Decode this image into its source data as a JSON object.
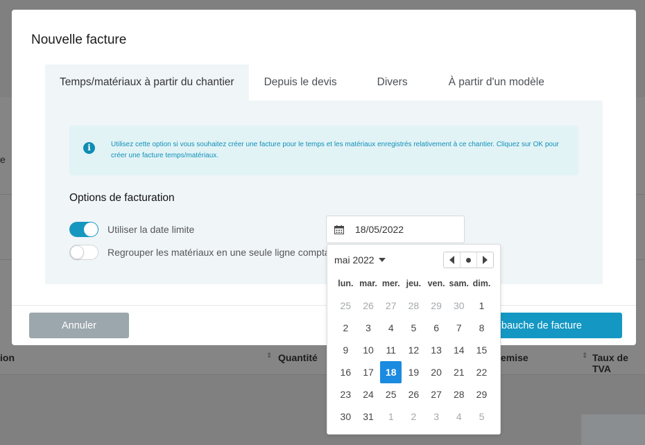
{
  "background": {
    "left_text": "e",
    "col_left": "ion",
    "col_quantite": "Quantité",
    "col_remise": "emise",
    "col_tva": "Taux de TVA"
  },
  "modal": {
    "title": "Nouvelle facture",
    "tabs": [
      {
        "label": "Temps/matériaux à partir du chantier",
        "active": true
      },
      {
        "label": "Depuis le devis",
        "active": false
      },
      {
        "label": "Divers",
        "active": false
      },
      {
        "label": "À partir d'un modèle",
        "active": false
      }
    ],
    "info_text": "Utilisez cette option si vous souhaitez créer une facture pour le temps et les matériaux enregistrés relativement à ce chantier. Cliquez sur OK pour créer une facture temps/matériaux.",
    "section_title": "Options de facturation",
    "options": [
      {
        "label": "Utiliser la date limite",
        "on": true
      },
      {
        "label": "Regrouper les matériaux en une seule ligne comptable",
        "on": false
      }
    ],
    "date_value": "18/05/2022",
    "cancel_label": "Annuler",
    "primary_label": "ébauche de facture"
  },
  "picker": {
    "month_label": "mai 2022",
    "weekdays": [
      "lun.",
      "mar.",
      "mer.",
      "jeu.",
      "ven.",
      "sam.",
      "dim."
    ],
    "days": [
      {
        "d": "25",
        "muted": true
      },
      {
        "d": "26",
        "muted": true
      },
      {
        "d": "27",
        "muted": true
      },
      {
        "d": "28",
        "muted": true
      },
      {
        "d": "29",
        "muted": true
      },
      {
        "d": "30",
        "muted": true
      },
      {
        "d": "1"
      },
      {
        "d": "2"
      },
      {
        "d": "3"
      },
      {
        "d": "4"
      },
      {
        "d": "5"
      },
      {
        "d": "6"
      },
      {
        "d": "7"
      },
      {
        "d": "8"
      },
      {
        "d": "9"
      },
      {
        "d": "10"
      },
      {
        "d": "11"
      },
      {
        "d": "12"
      },
      {
        "d": "13"
      },
      {
        "d": "14"
      },
      {
        "d": "15"
      },
      {
        "d": "16"
      },
      {
        "d": "17"
      },
      {
        "d": "18",
        "selected": true
      },
      {
        "d": "19"
      },
      {
        "d": "20"
      },
      {
        "d": "21"
      },
      {
        "d": "22"
      },
      {
        "d": "23"
      },
      {
        "d": "24"
      },
      {
        "d": "25"
      },
      {
        "d": "26"
      },
      {
        "d": "27"
      },
      {
        "d": "28"
      },
      {
        "d": "29"
      },
      {
        "d": "30"
      },
      {
        "d": "31"
      },
      {
        "d": "1",
        "muted": true
      },
      {
        "d": "2",
        "muted": true
      },
      {
        "d": "3",
        "muted": true
      },
      {
        "d": "4",
        "muted": true
      },
      {
        "d": "5",
        "muted": true
      }
    ]
  },
  "colors": {
    "accent": "#1497c3",
    "selected_day": "#1a8be0",
    "info_bg": "#e2f3f6",
    "info_text": "#0f90b8",
    "cancel_bg": "#9ca6ad"
  }
}
